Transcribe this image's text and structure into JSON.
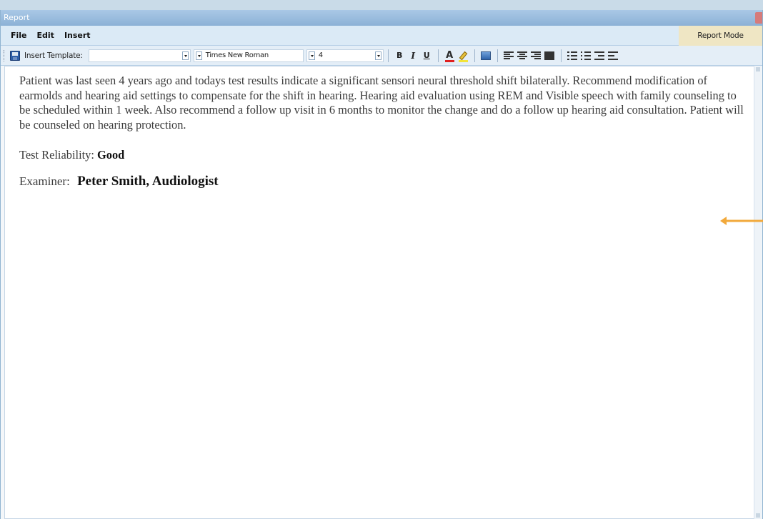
{
  "window": {
    "title": "Report"
  },
  "menubar": {
    "items": [
      "File",
      "Edit",
      "Insert"
    ],
    "mode_label": "Report Mode"
  },
  "toolbar": {
    "template_label": "Insert Template:",
    "template_value": "",
    "font_name": "Times New Roman",
    "font_size": "4",
    "bold_label": "B",
    "italic_label": "I",
    "underline_label": "U",
    "font_color_label": "A",
    "icons": [
      "save-icon",
      "bold-icon",
      "italic-icon",
      "underline-icon",
      "font-color-icon",
      "highlight-icon",
      "insert-image-icon",
      "align-left-icon",
      "align-center-icon",
      "align-right-icon",
      "align-justify-icon",
      "numbered-list-icon",
      "bullet-list-icon",
      "outdent-icon",
      "indent-icon"
    ]
  },
  "editor": {
    "paragraph": "Patient was last seen 4 years ago and  todays test results indicate a significant sensori neural threshold shift bilaterally.  Recommend modification of earmolds and hearing aid settings to compensate for the shift in hearing.  Hearing aid evaluation using REM and Visible speech with family counseling to be scheduled within 1 week. Also recommend a follow up visit in 6 months to monitor the change and do a follow up hearing aid consultation.  Patient will be counseled on hearing protection.",
    "reliability_label": "Test Reliability:",
    "reliability_value": "Good",
    "examiner_label": "Examiner:",
    "examiner_value": "Peter Smith, Audiologist"
  },
  "colors": {
    "accent_arrow": "#f2a93b",
    "font_color_bar": "#e02020",
    "highlight_bar": "#f2e33a"
  }
}
